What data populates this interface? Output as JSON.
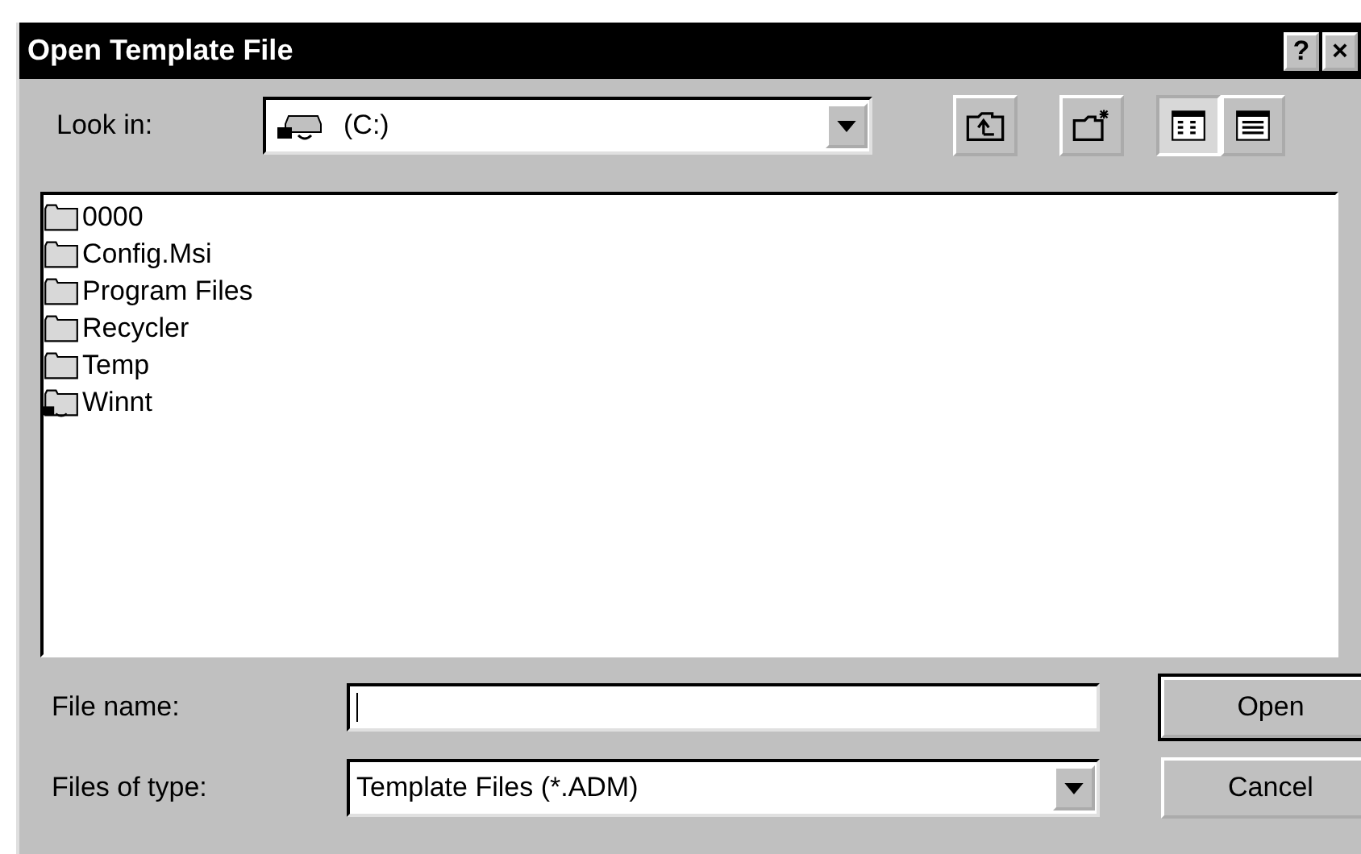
{
  "window": {
    "title": "Open Template File",
    "buttons": [
      "?",
      "×"
    ]
  },
  "look_in": {
    "label": "Look in:",
    "value": "(C:)"
  },
  "toolbar": [
    {
      "kind": "up-folder"
    },
    {
      "kind": "new-folder"
    },
    {
      "kind": "list-view",
      "selected": true
    },
    {
      "kind": "details-view",
      "selected": false
    }
  ],
  "files": [
    {
      "name": "0000",
      "kind": "folder"
    },
    {
      "name": "Config.Msi",
      "kind": "folder"
    },
    {
      "name": "Program Files",
      "kind": "folder"
    },
    {
      "name": "Recycler",
      "kind": "folder"
    },
    {
      "name": "Temp",
      "kind": "folder"
    },
    {
      "name": "Winnt",
      "kind": "shared-folder"
    }
  ],
  "file_name": {
    "label": "File name:"
  },
  "file_type": {
    "label": "Files of type:",
    "value": "Template Files (*.ADM)"
  },
  "buttons": [
    {
      "label": "Open",
      "default": true
    },
    {
      "label": "Cancel",
      "default": false
    }
  ]
}
